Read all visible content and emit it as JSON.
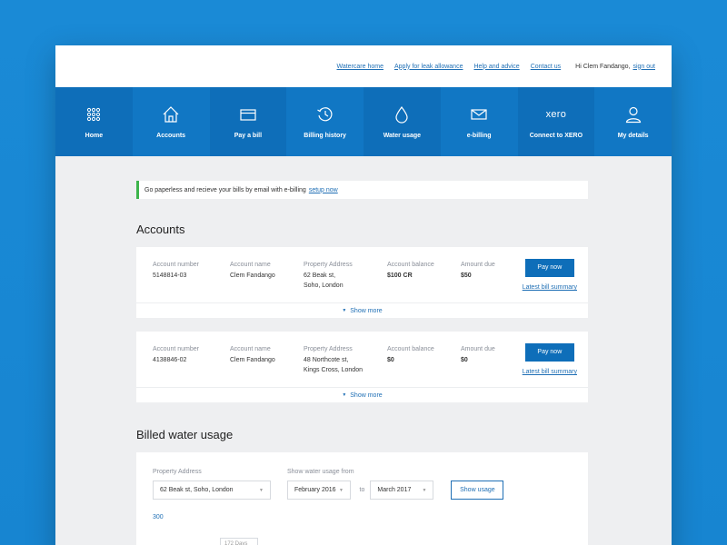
{
  "topbar": {
    "links": [
      "Watercare home",
      "Apply for leak allowance",
      "Help and advice",
      "Contact us"
    ],
    "greeting": "Hi Clem Fandango,",
    "signout": "sign out"
  },
  "nav": [
    {
      "label": "Home",
      "icon": "grid-icon"
    },
    {
      "label": "Accounts",
      "icon": "house-icon"
    },
    {
      "label": "Pay a bill",
      "icon": "card-icon"
    },
    {
      "label": "Billing history",
      "icon": "history-icon"
    },
    {
      "label": "Water usage",
      "icon": "drop-icon"
    },
    {
      "label": "e-billing",
      "icon": "mail-icon"
    },
    {
      "label": "Connect to XERO",
      "icon": "xero-icon",
      "icon_text": "xero"
    },
    {
      "label": "My details",
      "icon": "user-icon"
    }
  ],
  "banner": {
    "text": "Go paperless and recieve your bills by email with e-billing",
    "link": "setup now",
    "accent": "#3cb44b"
  },
  "accounts": {
    "title": "Accounts",
    "labels": {
      "number": "Account number",
      "name": "Account name",
      "address": "Property Address",
      "balance": "Account balance",
      "due": "Amount due"
    },
    "pay_label": "Pay now",
    "summary_label": "Latest bill summary",
    "show_more": "Show more",
    "items": [
      {
        "number": "5148814-03",
        "name": "Clem Fandango",
        "address1": "62 Beak st,",
        "address2": "Soho, London",
        "balance": "$100 CR",
        "due": "$50"
      },
      {
        "number": "4138846-02",
        "name": "Clem Fandango",
        "address1": "48 Northcote st,",
        "address2": "Kings Cross, London",
        "balance": "$0",
        "due": "$0"
      }
    ]
  },
  "usage": {
    "title": "Billed water usage",
    "address_label": "Property Address",
    "address_value": "62 Beak st, Soho, London",
    "range_label": "Show water usage from",
    "from": "February 2016",
    "to_word": "to",
    "to": "March 2017",
    "button": "Show usage",
    "y_top": "300",
    "tooltip": "172 Days"
  },
  "colors": {
    "brand": "#0e6eb9",
    "background": "#1a8ad6",
    "link": "#1f6fb5"
  }
}
